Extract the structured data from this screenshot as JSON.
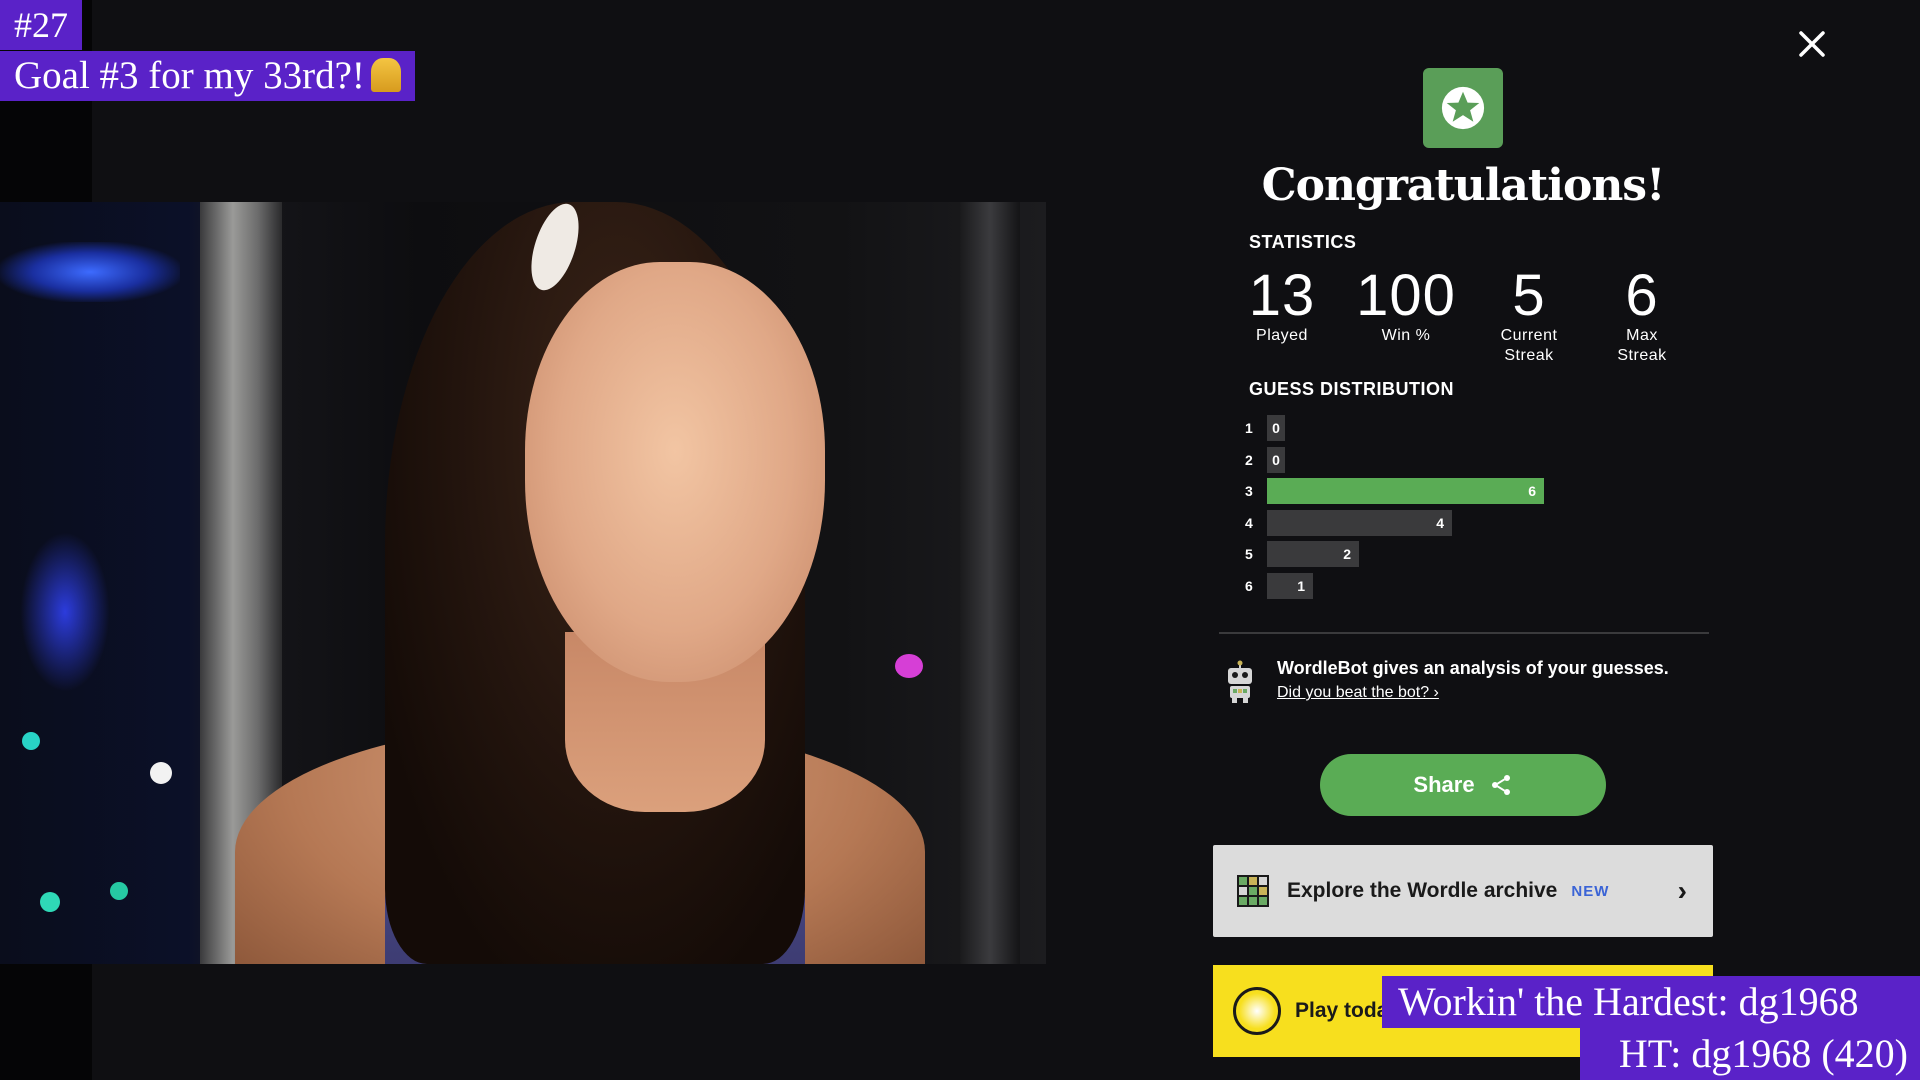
{
  "overlays": {
    "counter": "#27",
    "goal": "Goal #3 for my 33rd?!",
    "hardest": "Workin' the Hardest: dg1968",
    "ht": "HT: dg1968 (420)"
  },
  "modal": {
    "close_icon": "close-icon",
    "badge_icon": "star-icon",
    "title": "Congratulations!",
    "statistics_heading": "STATISTICS",
    "stats": [
      {
        "value": "13",
        "label": "Played"
      },
      {
        "value": "100",
        "label": "Win %"
      },
      {
        "value": "5",
        "label": "Current Streak"
      },
      {
        "value": "6",
        "label": "Max Streak"
      }
    ],
    "distribution_heading": "GUESS DISTRIBUTION",
    "distribution": [
      {
        "guess": "1",
        "count": 0
      },
      {
        "guess": "2",
        "count": 0
      },
      {
        "guess": "3",
        "count": 6,
        "current": true
      },
      {
        "guess": "4",
        "count": 4
      },
      {
        "guess": "5",
        "count": 2
      },
      {
        "guess": "6",
        "count": 1
      }
    ],
    "wordlebot_text": "WordleBot gives an analysis of your guesses.",
    "wordlebot_link": "Did you beat the bot? ›",
    "share_label": "Share",
    "archive_label": "Explore the Wordle archive",
    "archive_badge": "NEW",
    "bee_label": "Play today's Spelling Bee"
  },
  "colors": {
    "correct_green": "#5aac55",
    "bar_gray": "#3a3a3c",
    "overlay_purple": "#5a22c8",
    "bee_yellow": "#f7df1e"
  }
}
